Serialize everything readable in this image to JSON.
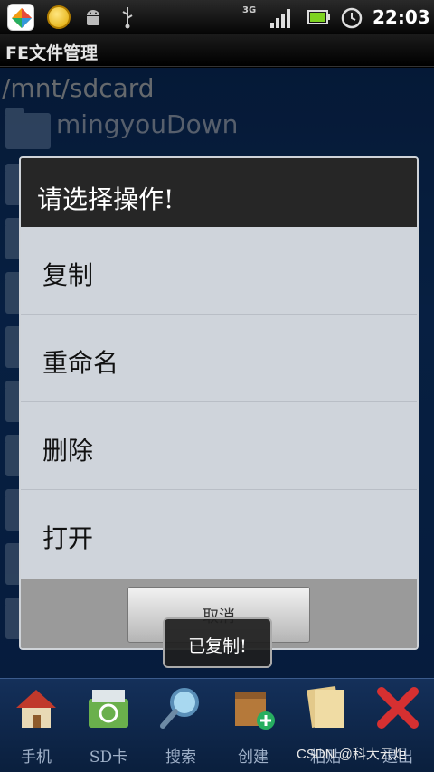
{
  "status_bar": {
    "network": "3G",
    "time": "22:03",
    "icons": [
      "app-store-icon",
      "coin-icon",
      "android-icon",
      "usb-icon",
      "signal-icon",
      "battery-icon",
      "alarm-clock-icon"
    ]
  },
  "app": {
    "title": "FE文件管理"
  },
  "browser": {
    "path": "/mnt/sdcard",
    "first_folder": "mingyouDown"
  },
  "dialog": {
    "title": "请选择操作!",
    "items": [
      {
        "label": "复制"
      },
      {
        "label": "重命名"
      },
      {
        "label": "删除"
      },
      {
        "label": "打开"
      }
    ],
    "cancel_label": "取消"
  },
  "toast": {
    "text": "已复制!"
  },
  "toolbar": {
    "items": [
      {
        "label": "手机",
        "icon": "house-icon"
      },
      {
        "label": "SD卡",
        "icon": "sd-card-recycle-icon"
      },
      {
        "label": "搜索",
        "icon": "magnifier-icon"
      },
      {
        "label": "创建",
        "icon": "create-box-icon"
      },
      {
        "label": "粘贴",
        "icon": "papers-icon"
      },
      {
        "label": "退出",
        "icon": "red-x-icon"
      }
    ]
  },
  "watermark": "CSDN @科大云炬",
  "colors": {
    "content_bg": "#0d3a78",
    "dialog_list_bg": "#cfd4db",
    "dialog_header_bg": "#262626"
  }
}
